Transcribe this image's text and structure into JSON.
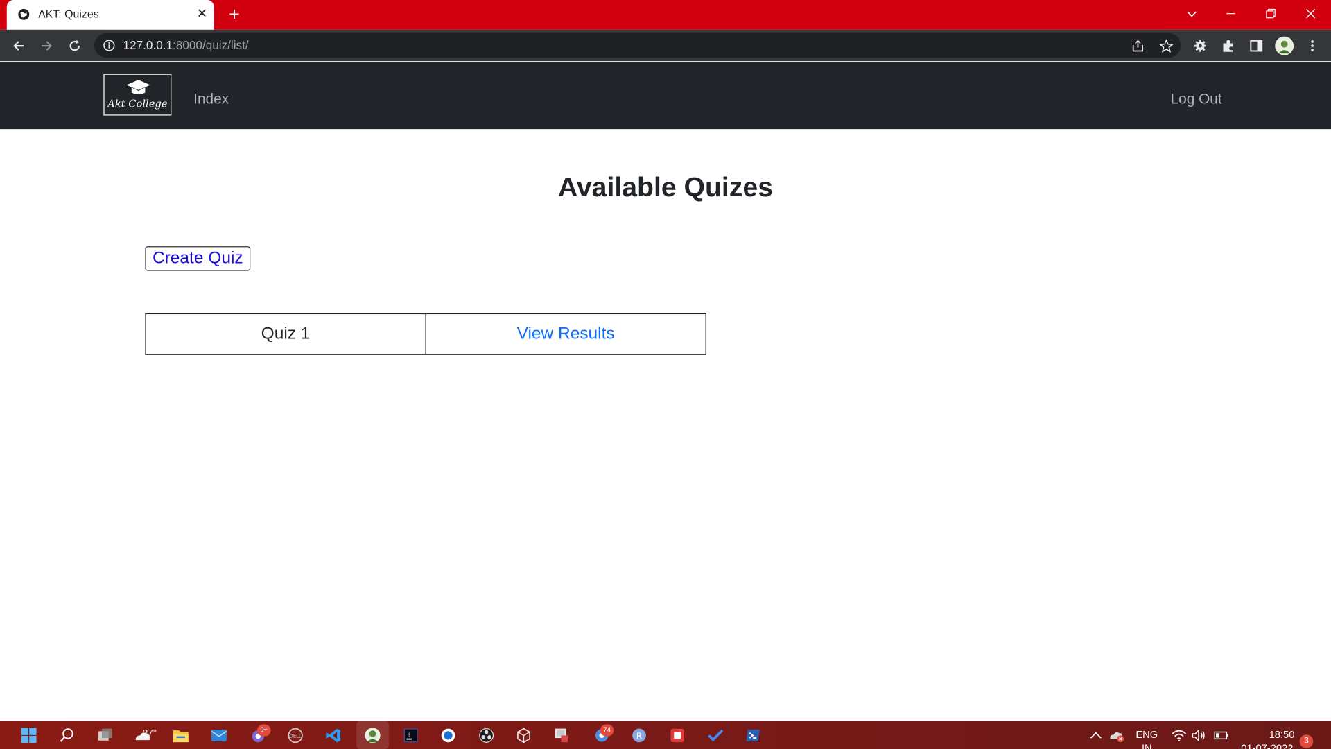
{
  "browser": {
    "tab_title": "AKT: Quizes",
    "url_host": "127.0.0.1",
    "url_path": ":8000/quiz/list/"
  },
  "site_nav": {
    "logo_text": "Akt College",
    "index_label": "Index",
    "logout_label": "Log Out"
  },
  "main": {
    "page_title": "Available Quizes",
    "create_button_label": "Create Quiz",
    "quizzes": [
      {
        "name": "Quiz 1",
        "action_label": "View Results"
      }
    ]
  },
  "taskbar": {
    "weather_temp": "27°",
    "teams_badge": "9+",
    "chat_badge": "74",
    "language_line1": "ENG",
    "language_line2": "IN",
    "time": "18:50",
    "date": "01-07-2022",
    "notification_count": "3"
  },
  "colors": {
    "tabstrip": "#d2000f",
    "navbar": "#212529",
    "link": "#0d6efd",
    "create_button_text": "#1a0dde"
  }
}
